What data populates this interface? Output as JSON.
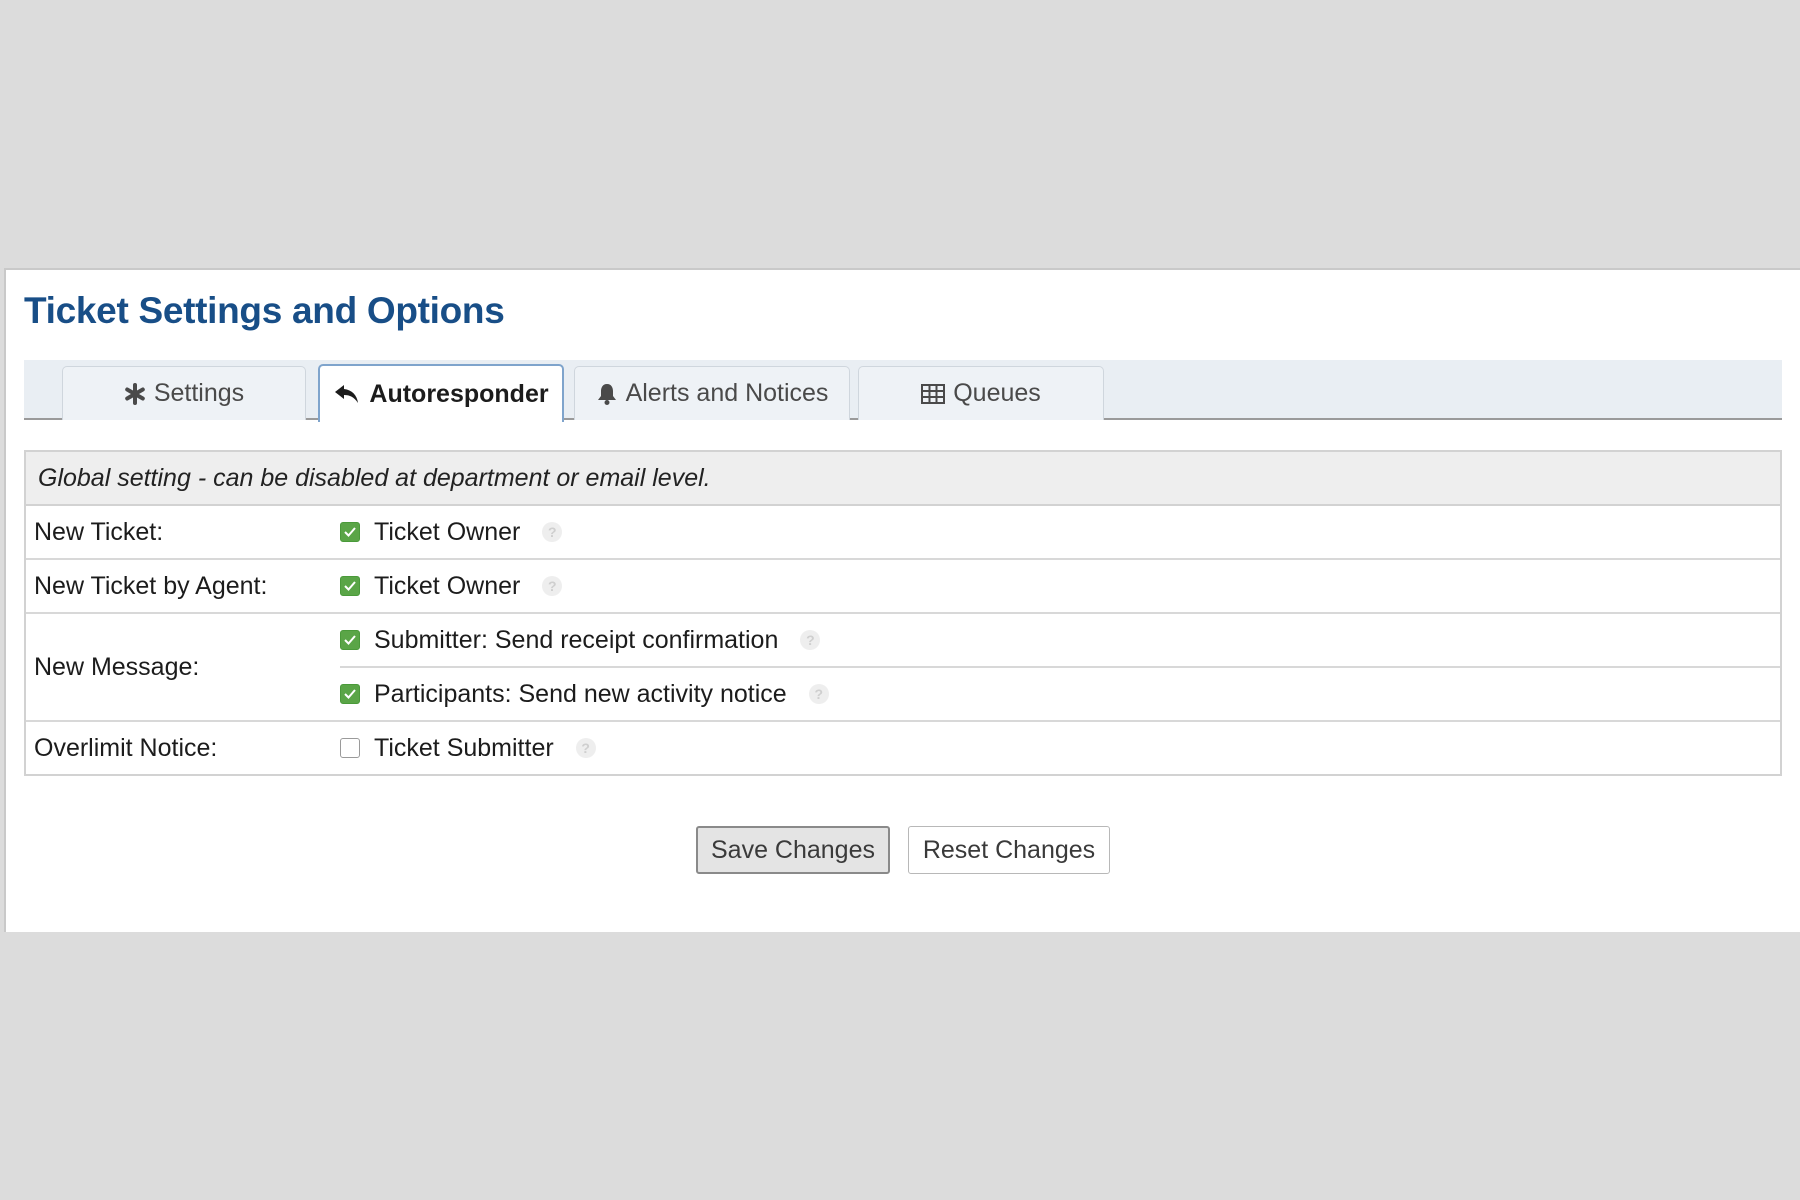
{
  "page": {
    "title": "Ticket Settings and Options"
  },
  "tabs": [
    {
      "label": "Settings",
      "icon": "asterisk-icon",
      "active": false
    },
    {
      "label": "Autoresponder",
      "icon": "reply-all-icon",
      "active": true
    },
    {
      "label": "Alerts and Notices",
      "icon": "bell-icon",
      "active": false
    },
    {
      "label": "Queues",
      "icon": "table-icon",
      "active": false
    }
  ],
  "notice": "Global setting - can be disabled at department or email level.",
  "rows": [
    {
      "label": "New Ticket:",
      "options": [
        {
          "label": "Ticket Owner",
          "checked": true
        }
      ]
    },
    {
      "label": "New Ticket by Agent:",
      "options": [
        {
          "label": "Ticket Owner",
          "checked": true
        }
      ]
    },
    {
      "label": "New Message:",
      "options": [
        {
          "label": "Submitter: Send receipt confirmation",
          "checked": true
        },
        {
          "label": "Participants: Send new activity notice",
          "checked": true
        }
      ]
    },
    {
      "label": "Overlimit Notice:",
      "options": [
        {
          "label": "Ticket Submitter",
          "checked": false
        }
      ]
    }
  ],
  "buttons": {
    "save_label": "Save Changes",
    "reset_label": "Reset Changes"
  },
  "colors": {
    "title": "#184e87",
    "checkbox_checked": "#5aa547",
    "active_tab_border": "#7fa4cc"
  }
}
